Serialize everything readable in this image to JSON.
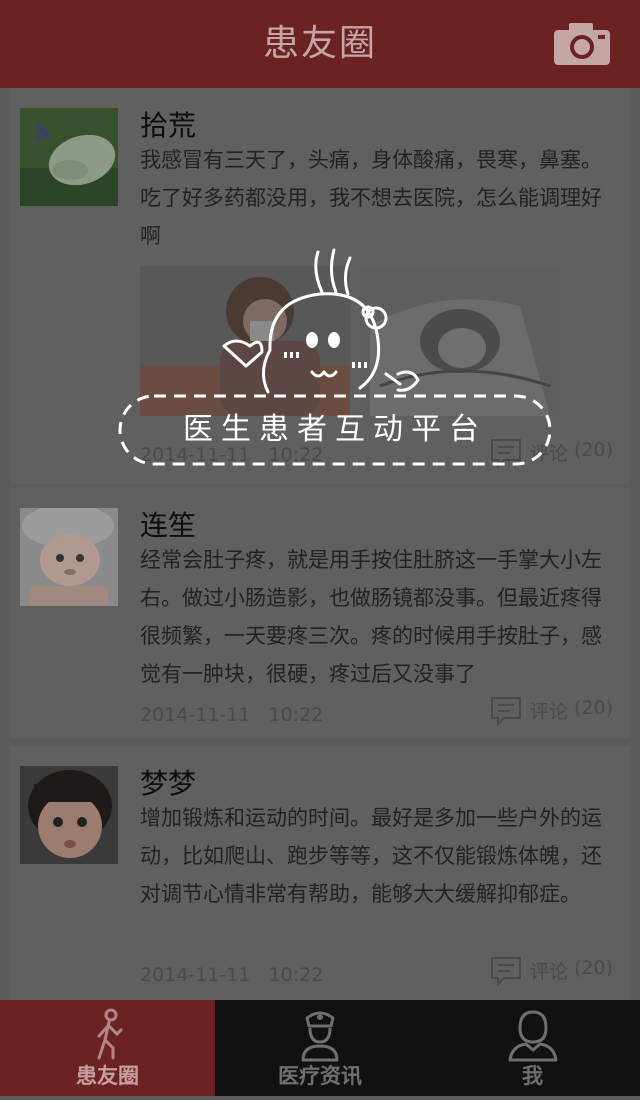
{
  "header": {
    "title": "患友圈",
    "camera_icon": "camera-icon"
  },
  "posts": [
    {
      "name": "拾荒",
      "text": "我感冒有三天了，头痛，身体酸痛，畏寒，鼻塞。吃了好多药都没用，我不想去医院，怎么能调理好啊",
      "date": "2014-11-11",
      "time": "10:22",
      "comment_label": "评论",
      "comment_count": "(20)"
    },
    {
      "name": "连笙",
      "text": "经常会肚子疼，就是用手按住肚脐这一手掌大小左右。做过小肠造影，也做肠镜都没事。但最近疼得很频繁，一天要疼三次。疼的时候用手按肚子，感觉有一肿块，很硬，疼过后又没事了",
      "date": "2014-11-11",
      "time": "10:22",
      "comment_label": "评论",
      "comment_count": "(20)"
    },
    {
      "name": "梦梦",
      "text": "增加锻炼和运动的时间。最好是多加一些户外的运动，比如爬山、跑步等等，这不仅能锻炼体魄，还对调节心情非常有帮助，能够大大缓解抑郁症。",
      "date": "2014-11-11",
      "time": "10:22",
      "comment_label": "评论",
      "comment_count": "(20)"
    }
  ],
  "overlay": {
    "tagline": "医生患者互动平台"
  },
  "tabs": [
    {
      "label": "患友圈",
      "icon": "walking-person-icon",
      "active": true
    },
    {
      "label": "医疗资讯",
      "icon": "nurse-icon",
      "active": false
    },
    {
      "label": "我",
      "icon": "user-icon",
      "active": false
    }
  ],
  "colors": {
    "brand": "#6b2322",
    "tabbar": "#111111",
    "card": "#606060",
    "background": "#5b5b5b"
  }
}
